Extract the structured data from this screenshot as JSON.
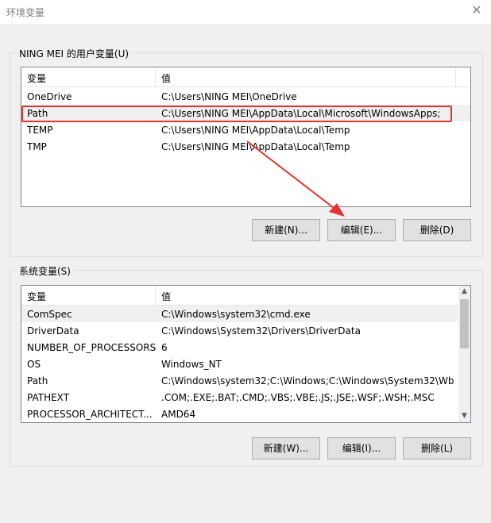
{
  "window": {
    "title": "环境变量",
    "close_glyph": "✕"
  },
  "user_vars": {
    "group_label": "NING MEI 的用户变量(U)",
    "col_name": "变量",
    "col_value": "值",
    "rows": [
      {
        "name": "OneDrive",
        "value": "C:\\Users\\NING MEI\\OneDrive"
      },
      {
        "name": "Path",
        "value": "C:\\Users\\NING MEI\\AppData\\Local\\Microsoft\\WindowsApps;"
      },
      {
        "name": "TEMP",
        "value": "C:\\Users\\NING MEI\\AppData\\Local\\Temp"
      },
      {
        "name": "TMP",
        "value": "C:\\Users\\NING MEI\\AppData\\Local\\Temp"
      }
    ],
    "buttons": {
      "new": "新建(N)...",
      "edit": "编辑(E)...",
      "delete": "删除(D)"
    }
  },
  "system_vars": {
    "group_label": "系统变量(S)",
    "col_name": "变量",
    "col_value": "值",
    "rows": [
      {
        "name": "ComSpec",
        "value": "C:\\Windows\\system32\\cmd.exe"
      },
      {
        "name": "DriverData",
        "value": "C:\\Windows\\System32\\Drivers\\DriverData"
      },
      {
        "name": "NUMBER_OF_PROCESSORS",
        "value": "6"
      },
      {
        "name": "OS",
        "value": "Windows_NT"
      },
      {
        "name": "Path",
        "value": "C:\\Windows\\system32;C:\\Windows;C:\\Windows\\System32\\Wb..."
      },
      {
        "name": "PATHEXT",
        "value": ".COM;.EXE;.BAT;.CMD;.VBS;.VBE;.JS;.JSE;.WSF;.WSH;.MSC"
      },
      {
        "name": "PROCESSOR_ARCHITECT...",
        "value": "AMD64"
      }
    ],
    "buttons": {
      "new": "新建(W)...",
      "edit": "编辑(I)...",
      "delete": "删除(L)"
    }
  },
  "annotation": {
    "color": "#e3342f"
  }
}
